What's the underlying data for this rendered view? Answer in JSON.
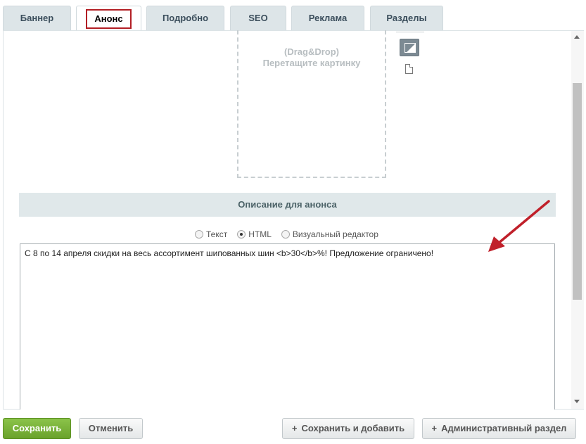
{
  "tabs": [
    {
      "label": "Баннер"
    },
    {
      "label": "Анонс",
      "active": true
    },
    {
      "label": "Подробно"
    },
    {
      "label": "SEO"
    },
    {
      "label": "Реклама"
    },
    {
      "label": "Разделы"
    }
  ],
  "dropzone": {
    "line1": "(Drag&Drop)",
    "line2": "Перетащите картинку"
  },
  "icons": [
    "image-icon",
    "file-icon"
  ],
  "section": {
    "title": "Описание для анонса"
  },
  "editor_modes": [
    {
      "label": "Текст",
      "checked": false
    },
    {
      "label": "HTML",
      "checked": true
    },
    {
      "label": "Визуальный редактор",
      "checked": false
    }
  ],
  "editor": {
    "value": "С 8 по 14 апреля скидки на весь ассортимент шипованных шин <b>30</b>%! Предложение ограничено!"
  },
  "buttons": {
    "save": "Сохранить",
    "cancel": "Отменить",
    "save_add": "Сохранить и добавить",
    "admin": "Административный раздел"
  },
  "colors": {
    "accent_red": "#b21e24",
    "save_green": "#6aa22b",
    "arrow_red": "#c0202a"
  }
}
